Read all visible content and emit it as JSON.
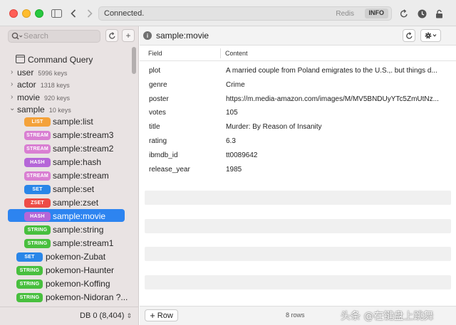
{
  "titlebar": {
    "status": "Connected.",
    "server": "Redis",
    "info_button": "INFO"
  },
  "sidebar": {
    "search_placeholder": "Search",
    "command_query_label": "Command Query",
    "groups": [
      {
        "name": "user",
        "count": "5996 keys",
        "expanded": false
      },
      {
        "name": "actor",
        "count": "1318 keys",
        "expanded": false
      },
      {
        "name": "movie",
        "count": "920 keys",
        "expanded": false
      },
      {
        "name": "sample",
        "count": "10 keys",
        "expanded": true
      }
    ],
    "sample_keys": [
      {
        "type": "LIST",
        "name": "sample:list",
        "color": "#f4a23a"
      },
      {
        "type": "STREAM",
        "name": "sample:stream3",
        "color": "#d97fd2"
      },
      {
        "type": "STREAM",
        "name": "sample:stream2",
        "color": "#d97fd2"
      },
      {
        "type": "HASH",
        "name": "sample:hash",
        "color": "#b566d8"
      },
      {
        "type": "STREAM",
        "name": "sample:stream",
        "color": "#d97fd2"
      },
      {
        "type": "SET",
        "name": "sample:set",
        "color": "#2a86e8"
      },
      {
        "type": "ZSET",
        "name": "sample:zset",
        "color": "#ee4c46"
      },
      {
        "type": "HASH",
        "name": "sample:movie",
        "color": "#b566d8",
        "selected": true
      },
      {
        "type": "STRING",
        "name": "sample:string",
        "color": "#48bf3e"
      },
      {
        "type": "STRING",
        "name": "sample:stream1",
        "color": "#48bf3e"
      }
    ],
    "root_keys": [
      {
        "type": "SET",
        "name": "pokemon-Zubat",
        "color": "#2a86e8"
      },
      {
        "type": "STRING",
        "name": "pokemon-Haunter",
        "color": "#48bf3e"
      },
      {
        "type": "STRING",
        "name": "pokemon-Koffing",
        "color": "#48bf3e"
      },
      {
        "type": "STRING",
        "name": "pokemon-Nidoran ?...",
        "color": "#48bf3e"
      }
    ],
    "db_selector": "DB 0 (8,404)"
  },
  "main": {
    "key_title": "sample:movie",
    "columns": {
      "field": "Field",
      "content": "Content"
    },
    "rows": [
      {
        "field": "plot",
        "content": "A married couple from Poland emigrates to the U.S.,. but things d..."
      },
      {
        "field": "genre",
        "content": "Crime"
      },
      {
        "field": "poster",
        "content": "https://m.media-amazon.com/images/M/MV5BNDUyYTc5ZmUtNz..."
      },
      {
        "field": "votes",
        "content": "105"
      },
      {
        "field": "title",
        "content": "Murder: By Reason of Insanity"
      },
      {
        "field": "rating",
        "content": "6.3"
      },
      {
        "field": "ibmdb_id",
        "content": "tt0089642"
      },
      {
        "field": "release_year",
        "content": "1985"
      }
    ],
    "add_row_label": "Row",
    "rows_count": "8 rows"
  },
  "watermark": "头条 @在键盘上跳舞"
}
